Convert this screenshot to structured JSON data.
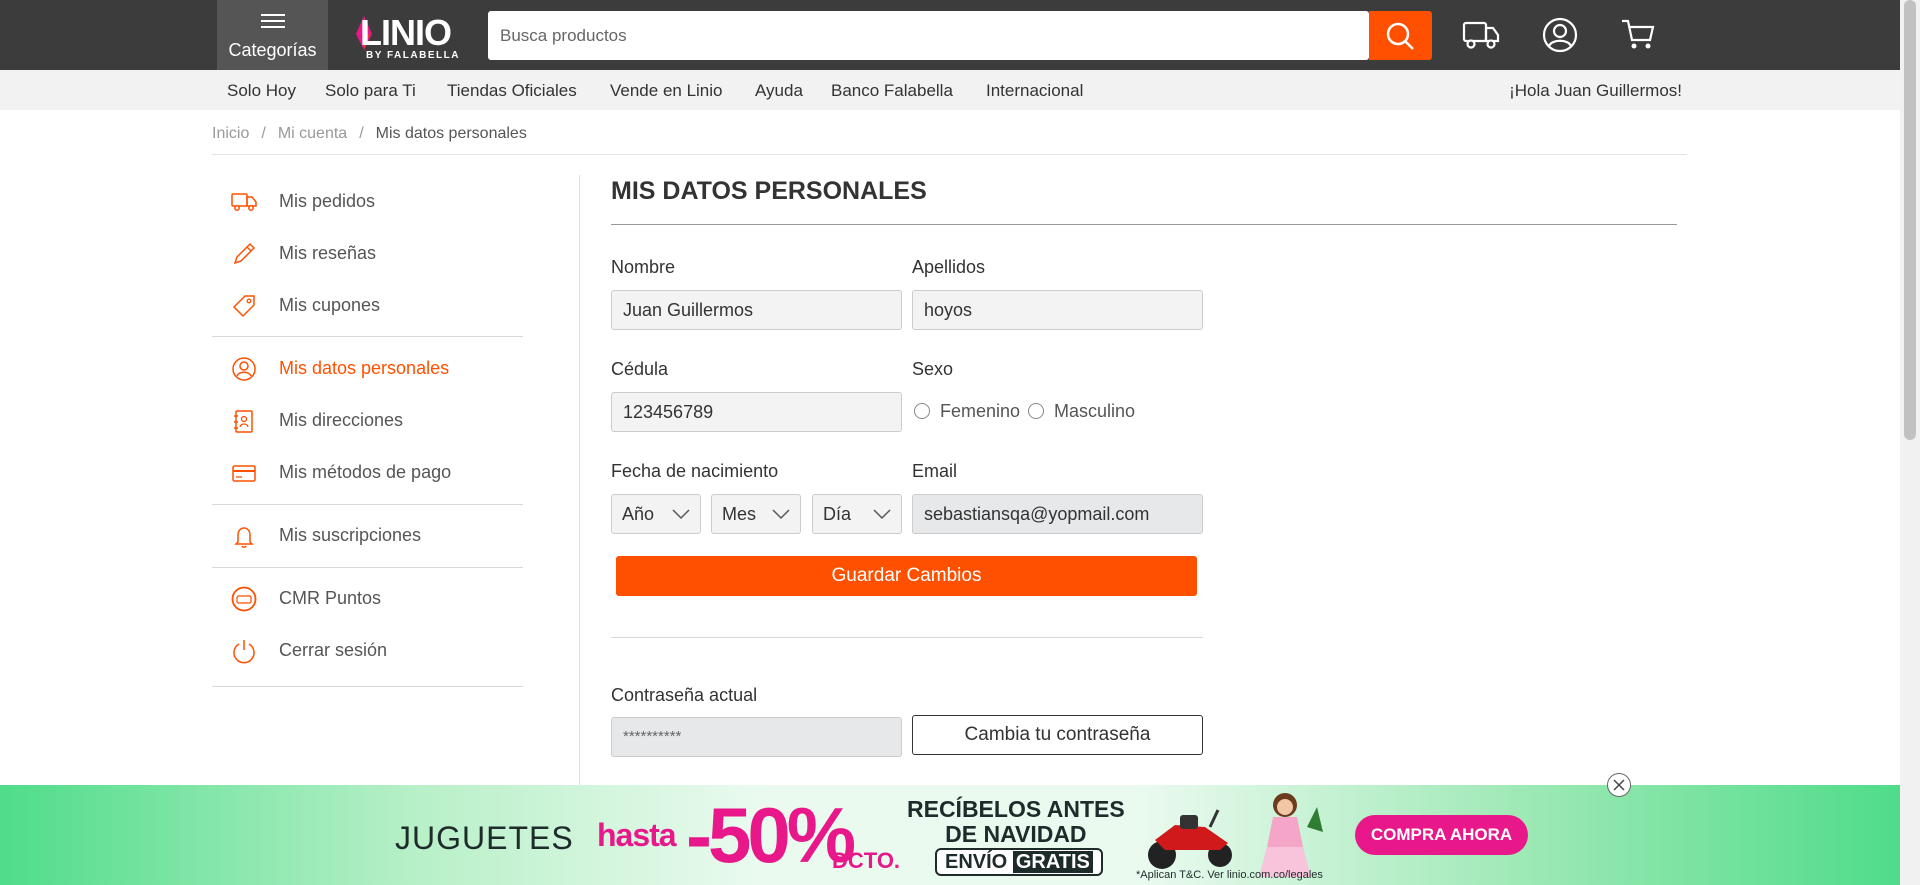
{
  "header": {
    "categories_label": "Categorías",
    "logo_text": "LINIO",
    "logo_sub": "BY FALABELLA",
    "search_placeholder": "Busca productos"
  },
  "nav": {
    "items": [
      "Solo Hoy",
      "Solo para Ti",
      "Tiendas Oficiales",
      "Vende en Linio",
      "Ayuda",
      "Banco Falabella",
      "Internacional"
    ],
    "greeting": "¡Hola Juan Guillermos!"
  },
  "breadcrumb": [
    "Inicio",
    "Mi cuenta",
    "Mis datos personales"
  ],
  "sidebar": {
    "items": [
      {
        "label": "Mis pedidos",
        "icon": "truck-icon"
      },
      {
        "label": "Mis reseñas",
        "icon": "pencil-icon"
      },
      {
        "label": "Mis cupones",
        "icon": "tag-icon"
      },
      {
        "label": "Mis datos personales",
        "icon": "user-icon",
        "active": true
      },
      {
        "label": "Mis direcciones",
        "icon": "address-book-icon"
      },
      {
        "label": "Mis métodos de pago",
        "icon": "credit-card-icon"
      },
      {
        "label": "Mis suscripciones",
        "icon": "bell-icon"
      },
      {
        "label": "CMR Puntos",
        "icon": "cmr-icon"
      },
      {
        "label": "Cerrar sesión",
        "icon": "power-icon"
      }
    ]
  },
  "form": {
    "title": "MIS DATOS PERSONALES",
    "nombre_label": "Nombre",
    "nombre_value": "Juan Guillermos",
    "apellidos_label": "Apellidos",
    "apellidos_value": "hoyos",
    "cedula_label": "Cédula",
    "cedula_value": "123456789",
    "sexo_label": "Sexo",
    "sexo_options": [
      "Femenino",
      "Masculino"
    ],
    "fecha_label": "Fecha de nacimiento",
    "fecha_year": "Año",
    "fecha_month": "Mes",
    "fecha_day": "Día",
    "email_label": "Email",
    "email_value": "sebastiansqa@yopmail.com",
    "save_label": "Guardar Cambios",
    "password_label": "Contraseña actual",
    "password_value": "**********",
    "change_password_label": "Cambia tu contraseña"
  },
  "banner": {
    "text_juguetes": "JUGUETES",
    "text_hasta": "hasta",
    "text_pct": "-50%",
    "text_dcto": "DCTO.",
    "text_rec1": "RECÍBELOS ANTES",
    "text_rec2": "DE NAVIDAD",
    "text_envio_a": "ENVÍO",
    "text_envio_b": "GRATIS",
    "text_legal": "*Aplican T&C. Ver linio.com.co/legales",
    "cta": "COMPRA AHORA"
  },
  "colors": {
    "brand": "#ff5000",
    "header_bg": "#3c3c3c",
    "promo_pink": "#e8188a",
    "promo_green": "#4fdc8a"
  }
}
